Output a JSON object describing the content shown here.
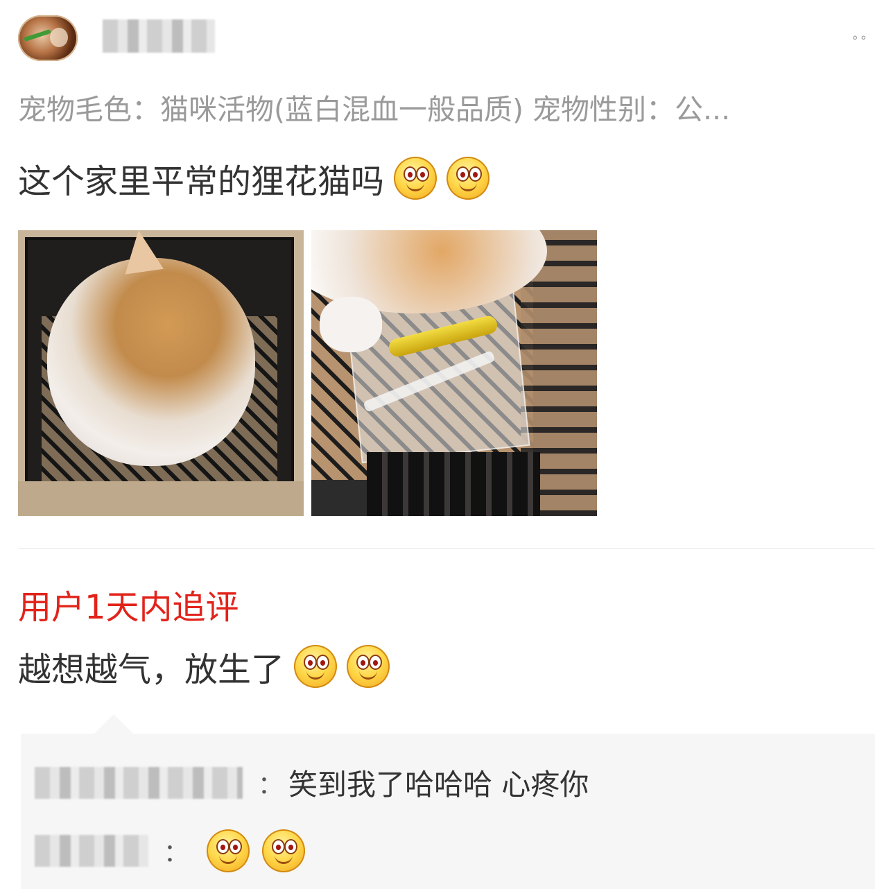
{
  "post": {
    "spec": "宠物毛色：猫咪活物(蓝白混血一般品质)  宠物性别：公...",
    "menu": "∘∘",
    "review_text": "这个家里平常的狸花猫吗",
    "review_emojis": [
      "smile-emoji",
      "smile-emoji"
    ]
  },
  "follow_up": {
    "title": "用户1天内追评",
    "text": "越想越气，放生了",
    "emojis": [
      "smile-emoji",
      "smile-emoji"
    ]
  },
  "replies": [
    {
      "colon": "：",
      "text": "笑到我了哈哈哈 心疼你"
    },
    {
      "colon": "：",
      "emojis": [
        "smile-emoji",
        "smile-emoji"
      ]
    }
  ]
}
